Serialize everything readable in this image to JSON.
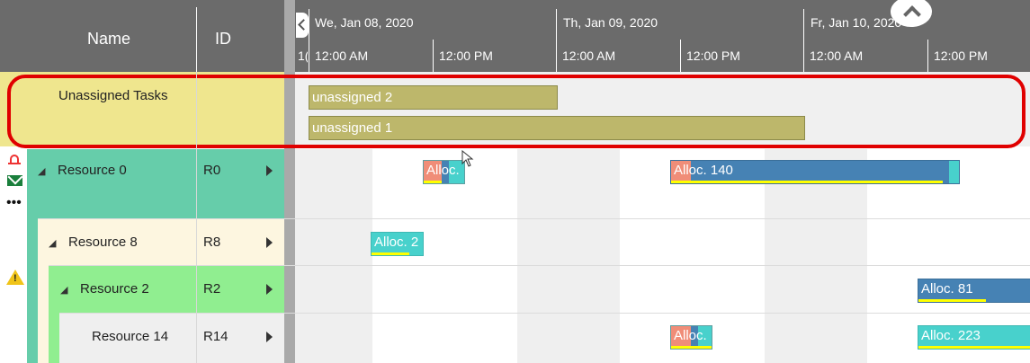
{
  "header": {
    "name_col": "Name",
    "id_col": "ID",
    "days": [
      "We, Jan 08, 2020",
      "Th, Jan 09, 2020",
      "Fr, Jan 10, 2020"
    ],
    "times": [
      "1(",
      "12:00 AM",
      "12:00 PM",
      "12:00 AM",
      "12:00 PM",
      "12:00 AM",
      "12:00 PM"
    ]
  },
  "unassigned": {
    "label": "Unassigned Tasks",
    "tasks": [
      "unassigned 2",
      "unassigned 1"
    ]
  },
  "rows": [
    {
      "name": "Resource 0",
      "id": "R0",
      "allocs": [
        "Alloc.",
        "Alloc. 140"
      ]
    },
    {
      "name": "Resource 8",
      "id": "R8",
      "allocs": [
        "Alloc. 2"
      ]
    },
    {
      "name": "Resource 2",
      "id": "R2",
      "allocs": [
        "Alloc. 81"
      ]
    },
    {
      "name": "Resource 14",
      "id": "R14",
      "allocs": [
        "Alloc.",
        "Alloc. 223"
      ]
    }
  ],
  "colors": {
    "header_bg": "#6b6b6b",
    "unassigned_bg": "#efe68e",
    "resource0_bg": "#66cdaa",
    "resource8_bg": "#fdf6e0",
    "resource2_bg": "#90ee90",
    "highlight_border": "#e00000",
    "task_bar": "#bdb76b",
    "alloc_blue": "#4682b4",
    "alloc_teal": "#48d1cc"
  }
}
